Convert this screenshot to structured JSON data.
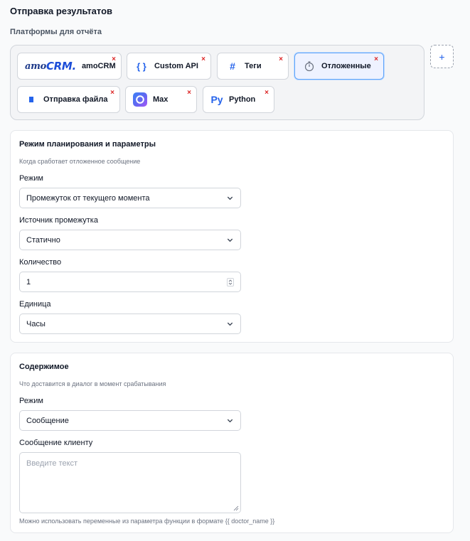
{
  "page": {
    "title": "Отправка результатов",
    "platforms_label": "Платформы для отчёта"
  },
  "platforms": [
    {
      "id": "amocrm",
      "logo_text": "amo",
      "logo_text_2": "CRM.",
      "label": "amoCRM",
      "icon": "amocrm-logo",
      "active": false,
      "remove": "×"
    },
    {
      "id": "custom-api",
      "icon_glyph": "{ }",
      "label": "Custom API",
      "icon": "braces-icon",
      "active": false,
      "remove": "×"
    },
    {
      "id": "tags",
      "icon_glyph": "#",
      "label": "Теги",
      "icon": "hash-icon",
      "active": false,
      "remove": "×"
    },
    {
      "id": "delayed",
      "icon_glyph": "⏱",
      "label": "Отложенные",
      "icon": "stopwatch-icon",
      "active": true,
      "remove": "×"
    },
    {
      "id": "send-file",
      "label": "Отправка файла",
      "icon": "file-icon",
      "active": false,
      "remove": "×"
    },
    {
      "id": "max",
      "label": "Max",
      "icon": "max-logo",
      "active": false,
      "remove": "×"
    },
    {
      "id": "python",
      "icon_glyph": "Py",
      "label": "Python",
      "icon": "python-icon",
      "active": false,
      "remove": "×"
    }
  ],
  "add_button": {
    "label": "+"
  },
  "schedule": {
    "title": "Режим планирования и параметры",
    "subtitle": "Когда сработает отложенное сообщение",
    "mode_label": "Режим",
    "mode_value": "Промежуток от текущего момента",
    "source_label": "Источник промежутка",
    "source_value": "Статично",
    "quantity_label": "Количество",
    "quantity_value": "1",
    "unit_label": "Единица",
    "unit_value": "Часы"
  },
  "content": {
    "title": "Содержимое",
    "subtitle": "Что доставится в диалог в момент срабатывания",
    "mode_label": "Режим",
    "mode_value": "Сообщение",
    "message_label": "Сообщение клиенту",
    "message_placeholder": "Введите текст",
    "hint": "Можно использовать переменные из параметра функции в формате {{ doctor_name }}"
  },
  "colors": {
    "accent": "#2563eb",
    "remove": "#dc2626",
    "active_chip_border": "#60a5fa"
  }
}
